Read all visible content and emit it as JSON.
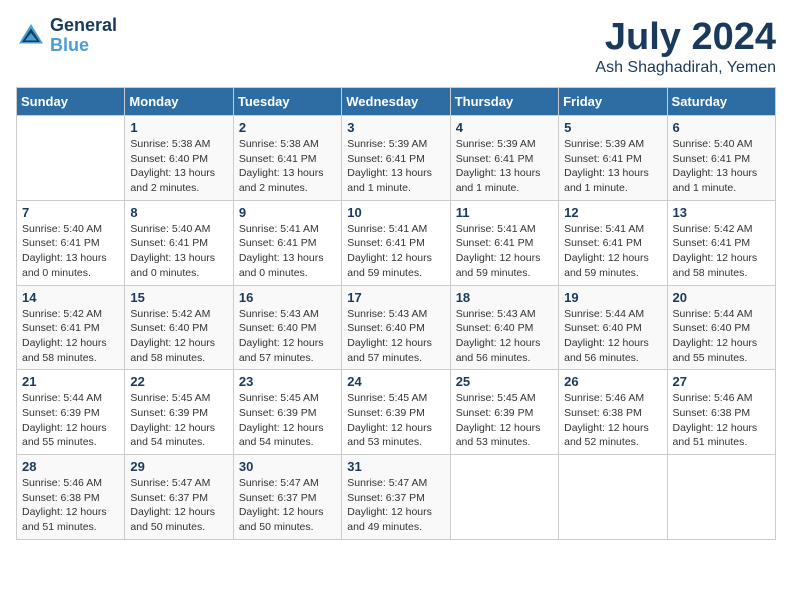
{
  "header": {
    "logo_line1": "General",
    "logo_line2": "Blue",
    "title": "July 2024",
    "subtitle": "Ash Shaghadirah, Yemen"
  },
  "weekdays": [
    "Sunday",
    "Monday",
    "Tuesday",
    "Wednesday",
    "Thursday",
    "Friday",
    "Saturday"
  ],
  "weeks": [
    [
      {
        "day": "",
        "sunrise": "",
        "sunset": "",
        "daylight": ""
      },
      {
        "day": "1",
        "sunrise": "Sunrise: 5:38 AM",
        "sunset": "Sunset: 6:40 PM",
        "daylight": "Daylight: 13 hours and 2 minutes."
      },
      {
        "day": "2",
        "sunrise": "Sunrise: 5:38 AM",
        "sunset": "Sunset: 6:41 PM",
        "daylight": "Daylight: 13 hours and 2 minutes."
      },
      {
        "day": "3",
        "sunrise": "Sunrise: 5:39 AM",
        "sunset": "Sunset: 6:41 PM",
        "daylight": "Daylight: 13 hours and 1 minute."
      },
      {
        "day": "4",
        "sunrise": "Sunrise: 5:39 AM",
        "sunset": "Sunset: 6:41 PM",
        "daylight": "Daylight: 13 hours and 1 minute."
      },
      {
        "day": "5",
        "sunrise": "Sunrise: 5:39 AM",
        "sunset": "Sunset: 6:41 PM",
        "daylight": "Daylight: 13 hours and 1 minute."
      },
      {
        "day": "6",
        "sunrise": "Sunrise: 5:40 AM",
        "sunset": "Sunset: 6:41 PM",
        "daylight": "Daylight: 13 hours and 1 minute."
      }
    ],
    [
      {
        "day": "7",
        "sunrise": "Sunrise: 5:40 AM",
        "sunset": "Sunset: 6:41 PM",
        "daylight": "Daylight: 13 hours and 0 minutes."
      },
      {
        "day": "8",
        "sunrise": "Sunrise: 5:40 AM",
        "sunset": "Sunset: 6:41 PM",
        "daylight": "Daylight: 13 hours and 0 minutes."
      },
      {
        "day": "9",
        "sunrise": "Sunrise: 5:41 AM",
        "sunset": "Sunset: 6:41 PM",
        "daylight": "Daylight: 13 hours and 0 minutes."
      },
      {
        "day": "10",
        "sunrise": "Sunrise: 5:41 AM",
        "sunset": "Sunset: 6:41 PM",
        "daylight": "Daylight: 12 hours and 59 minutes."
      },
      {
        "day": "11",
        "sunrise": "Sunrise: 5:41 AM",
        "sunset": "Sunset: 6:41 PM",
        "daylight": "Daylight: 12 hours and 59 minutes."
      },
      {
        "day": "12",
        "sunrise": "Sunrise: 5:41 AM",
        "sunset": "Sunset: 6:41 PM",
        "daylight": "Daylight: 12 hours and 59 minutes."
      },
      {
        "day": "13",
        "sunrise": "Sunrise: 5:42 AM",
        "sunset": "Sunset: 6:41 PM",
        "daylight": "Daylight: 12 hours and 58 minutes."
      }
    ],
    [
      {
        "day": "14",
        "sunrise": "Sunrise: 5:42 AM",
        "sunset": "Sunset: 6:41 PM",
        "daylight": "Daylight: 12 hours and 58 minutes."
      },
      {
        "day": "15",
        "sunrise": "Sunrise: 5:42 AM",
        "sunset": "Sunset: 6:40 PM",
        "daylight": "Daylight: 12 hours and 58 minutes."
      },
      {
        "day": "16",
        "sunrise": "Sunrise: 5:43 AM",
        "sunset": "Sunset: 6:40 PM",
        "daylight": "Daylight: 12 hours and 57 minutes."
      },
      {
        "day": "17",
        "sunrise": "Sunrise: 5:43 AM",
        "sunset": "Sunset: 6:40 PM",
        "daylight": "Daylight: 12 hours and 57 minutes."
      },
      {
        "day": "18",
        "sunrise": "Sunrise: 5:43 AM",
        "sunset": "Sunset: 6:40 PM",
        "daylight": "Daylight: 12 hours and 56 minutes."
      },
      {
        "day": "19",
        "sunrise": "Sunrise: 5:44 AM",
        "sunset": "Sunset: 6:40 PM",
        "daylight": "Daylight: 12 hours and 56 minutes."
      },
      {
        "day": "20",
        "sunrise": "Sunrise: 5:44 AM",
        "sunset": "Sunset: 6:40 PM",
        "daylight": "Daylight: 12 hours and 55 minutes."
      }
    ],
    [
      {
        "day": "21",
        "sunrise": "Sunrise: 5:44 AM",
        "sunset": "Sunset: 6:39 PM",
        "daylight": "Daylight: 12 hours and 55 minutes."
      },
      {
        "day": "22",
        "sunrise": "Sunrise: 5:45 AM",
        "sunset": "Sunset: 6:39 PM",
        "daylight": "Daylight: 12 hours and 54 minutes."
      },
      {
        "day": "23",
        "sunrise": "Sunrise: 5:45 AM",
        "sunset": "Sunset: 6:39 PM",
        "daylight": "Daylight: 12 hours and 54 minutes."
      },
      {
        "day": "24",
        "sunrise": "Sunrise: 5:45 AM",
        "sunset": "Sunset: 6:39 PM",
        "daylight": "Daylight: 12 hours and 53 minutes."
      },
      {
        "day": "25",
        "sunrise": "Sunrise: 5:45 AM",
        "sunset": "Sunset: 6:39 PM",
        "daylight": "Daylight: 12 hours and 53 minutes."
      },
      {
        "day": "26",
        "sunrise": "Sunrise: 5:46 AM",
        "sunset": "Sunset: 6:38 PM",
        "daylight": "Daylight: 12 hours and 52 minutes."
      },
      {
        "day": "27",
        "sunrise": "Sunrise: 5:46 AM",
        "sunset": "Sunset: 6:38 PM",
        "daylight": "Daylight: 12 hours and 51 minutes."
      }
    ],
    [
      {
        "day": "28",
        "sunrise": "Sunrise: 5:46 AM",
        "sunset": "Sunset: 6:38 PM",
        "daylight": "Daylight: 12 hours and 51 minutes."
      },
      {
        "day": "29",
        "sunrise": "Sunrise: 5:47 AM",
        "sunset": "Sunset: 6:37 PM",
        "daylight": "Daylight: 12 hours and 50 minutes."
      },
      {
        "day": "30",
        "sunrise": "Sunrise: 5:47 AM",
        "sunset": "Sunset: 6:37 PM",
        "daylight": "Daylight: 12 hours and 50 minutes."
      },
      {
        "day": "31",
        "sunrise": "Sunrise: 5:47 AM",
        "sunset": "Sunset: 6:37 PM",
        "daylight": "Daylight: 12 hours and 49 minutes."
      },
      {
        "day": "",
        "sunrise": "",
        "sunset": "",
        "daylight": ""
      },
      {
        "day": "",
        "sunrise": "",
        "sunset": "",
        "daylight": ""
      },
      {
        "day": "",
        "sunrise": "",
        "sunset": "",
        "daylight": ""
      }
    ]
  ]
}
